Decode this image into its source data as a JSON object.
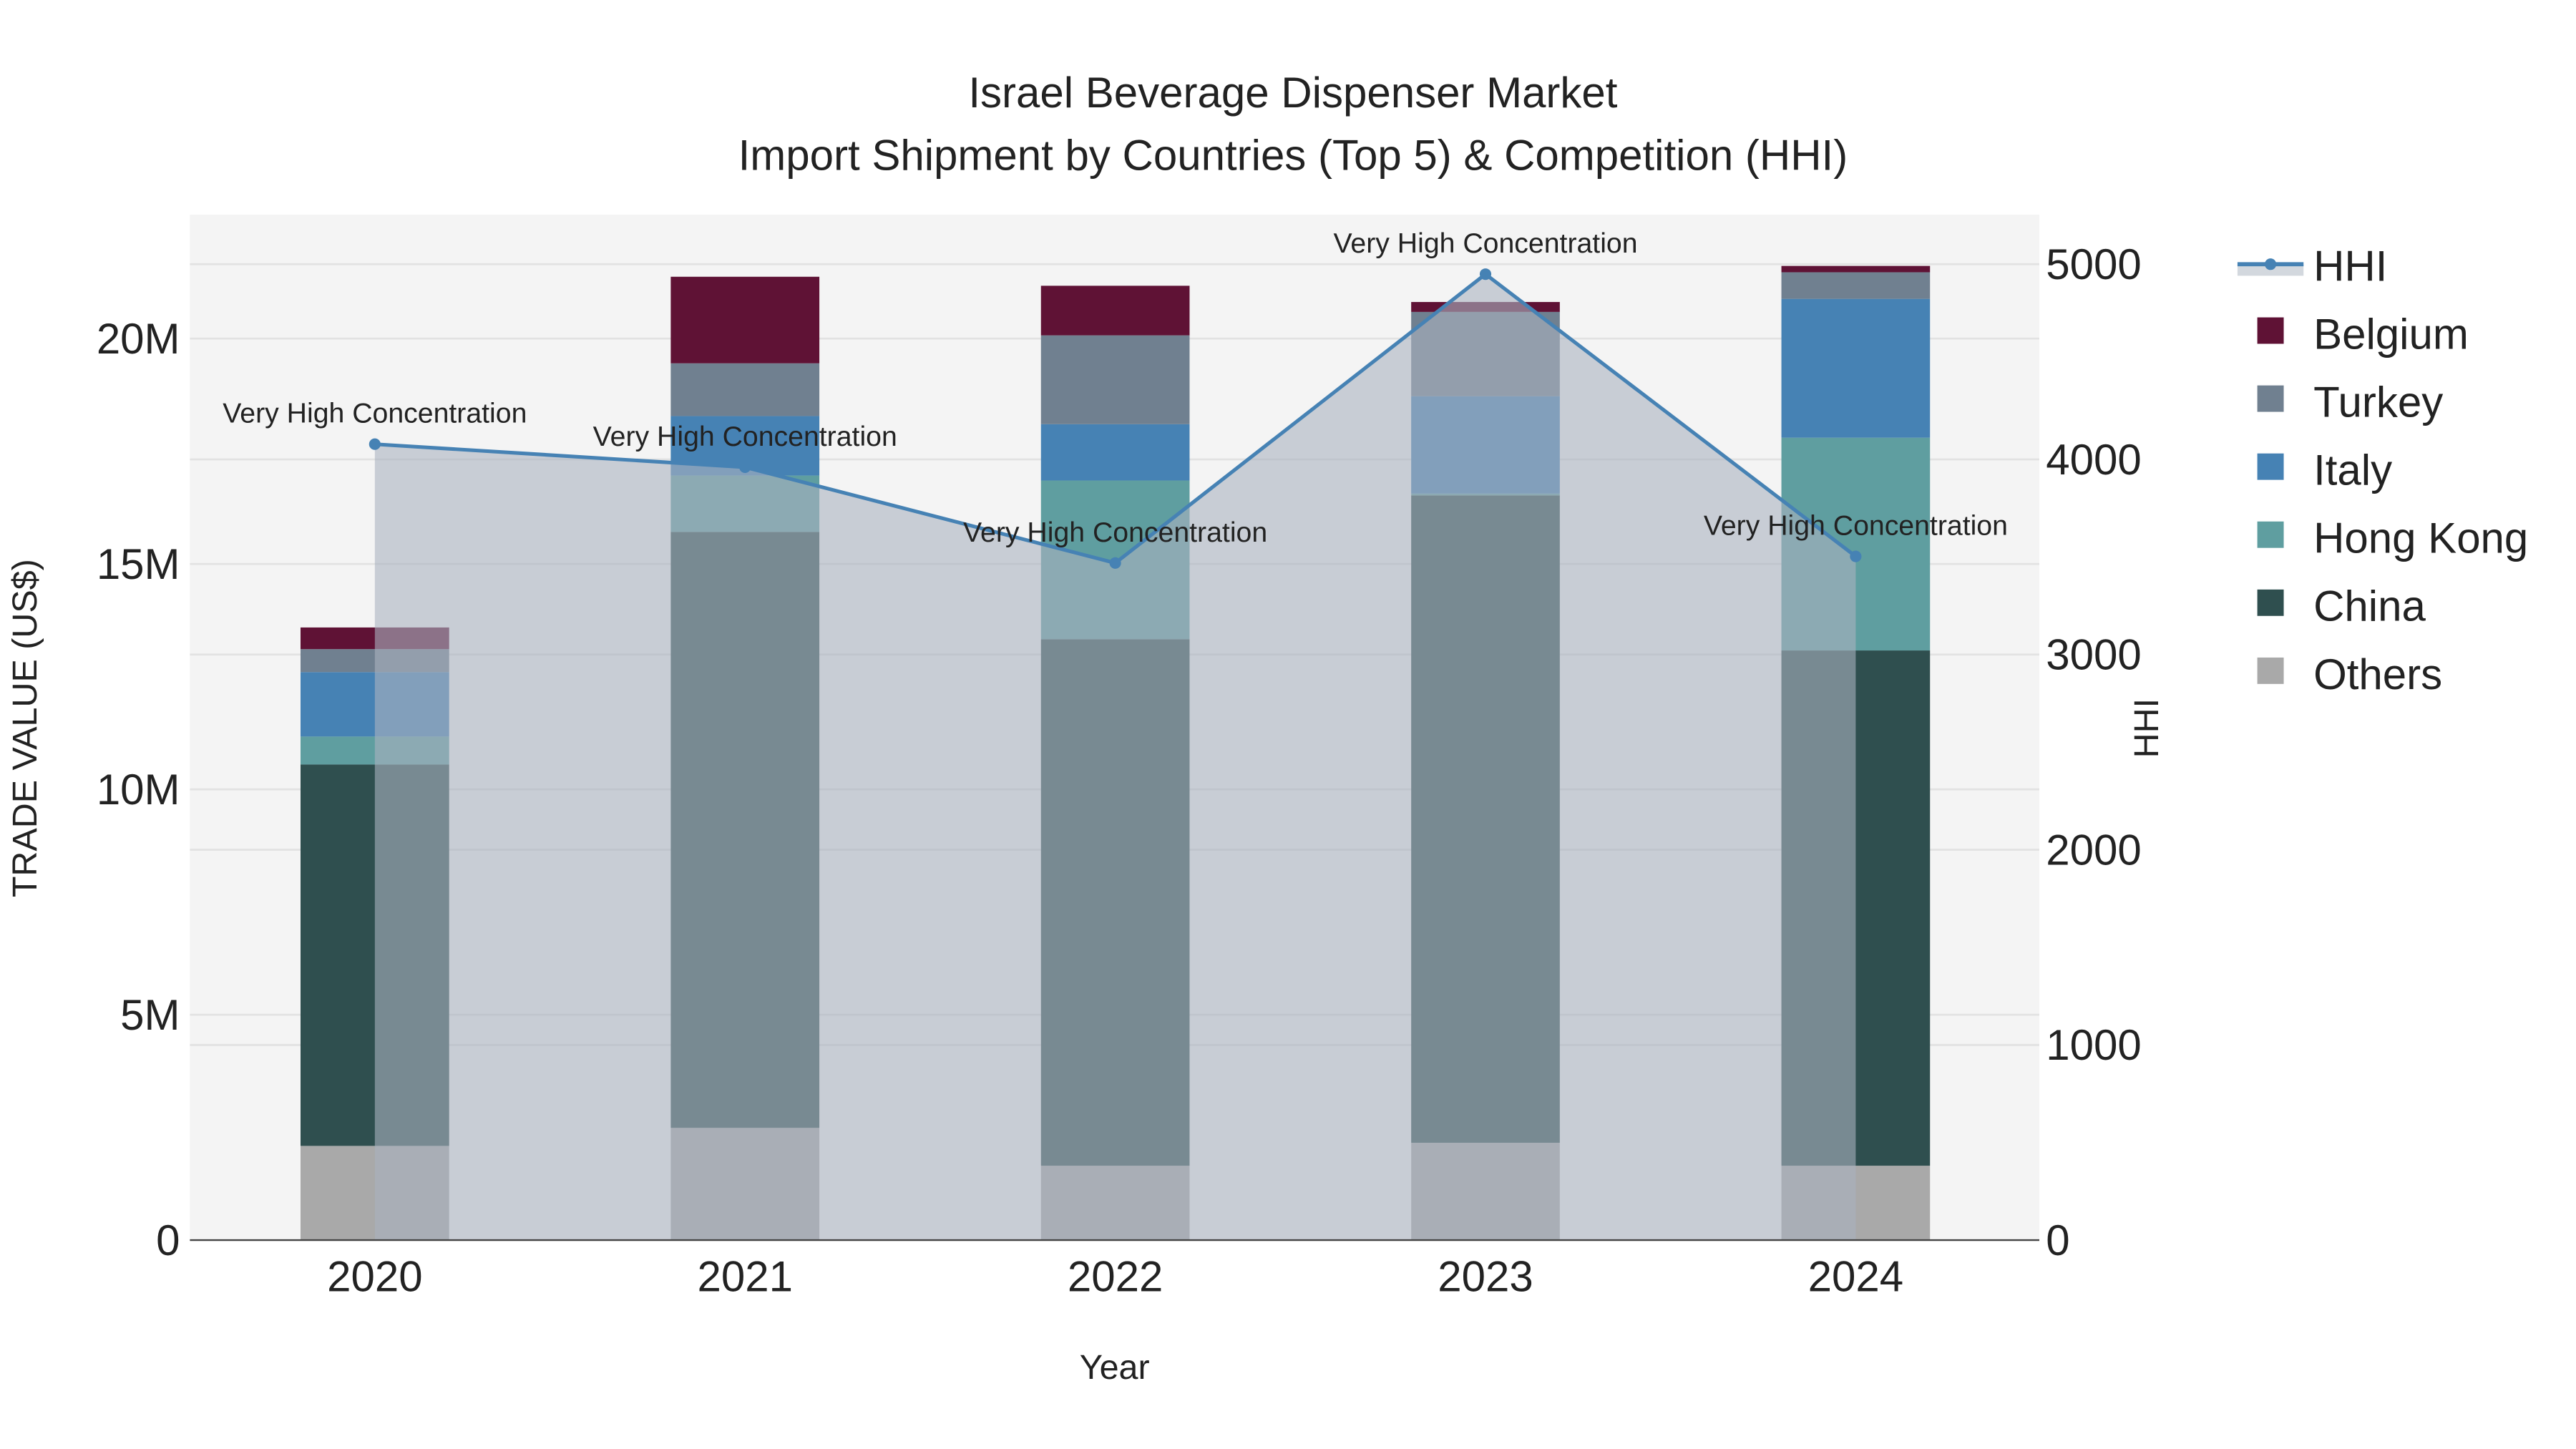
{
  "chart_data": {
    "type": "bar",
    "stacked": true,
    "title": "Israel Beverage Dispenser Market",
    "subtitle": "Import Shipment by Countries (Top 5) & Competition (HHI)",
    "xlabel": "Year",
    "ylabel": "TRADE VALUE (US$)",
    "y2label": "HHI",
    "categories": [
      "2020",
      "2021",
      "2022",
      "2023",
      "2024"
    ],
    "ylim": [
      0,
      22700000
    ],
    "y2lim": [
      0,
      5250
    ],
    "yticks": [
      {
        "v": 0,
        "label": "0"
      },
      {
        "v": 5000000,
        "label": "5M"
      },
      {
        "v": 10000000,
        "label": "10M"
      },
      {
        "v": 15000000,
        "label": "15M"
      },
      {
        "v": 20000000,
        "label": "20M"
      }
    ],
    "y2ticks": [
      {
        "v": 0,
        "label": "0"
      },
      {
        "v": 1000,
        "label": "1000"
      },
      {
        "v": 2000,
        "label": "2000"
      },
      {
        "v": 3000,
        "label": "3000"
      },
      {
        "v": 4000,
        "label": "4000"
      },
      {
        "v": 5000,
        "label": "5000"
      }
    ],
    "grid": true,
    "legend_position": "right",
    "series": [
      {
        "name": "Others",
        "color": "#a9a9a9",
        "values": [
          2090000,
          2490000,
          1650000,
          2160000,
          1650000
        ]
      },
      {
        "name": "China",
        "color": "#2f4f4f",
        "values": [
          8460000,
          13220000,
          11680000,
          14360000,
          11430000
        ]
      },
      {
        "name": "Hong Kong",
        "color": "#5f9ea0",
        "values": [
          620000,
          1250000,
          3520000,
          40000,
          4720000
        ]
      },
      {
        "name": "Italy",
        "color": "#4682b4",
        "values": [
          1430000,
          1320000,
          1250000,
          2160000,
          3080000
        ]
      },
      {
        "name": "Turkey",
        "color": "#708090",
        "values": [
          510000,
          1170000,
          1970000,
          1870000,
          590000
        ]
      },
      {
        "name": "Belgium",
        "color": "#5f1235",
        "values": [
          480000,
          1920000,
          1100000,
          220000,
          140000
        ]
      }
    ],
    "line": {
      "name": "HHI",
      "color": "#4682b4",
      "axis": "right",
      "values": [
        4078,
        3960,
        3469,
        4949,
        3503
      ],
      "annotations": [
        "Very High Concentration",
        "Very High Concentration",
        "Very High Concentration",
        "Very High Concentration",
        "Very High Concentration"
      ]
    },
    "legend": [
      "HHI",
      "Belgium",
      "Turkey",
      "Italy",
      "Hong Kong",
      "China",
      "Others"
    ]
  }
}
